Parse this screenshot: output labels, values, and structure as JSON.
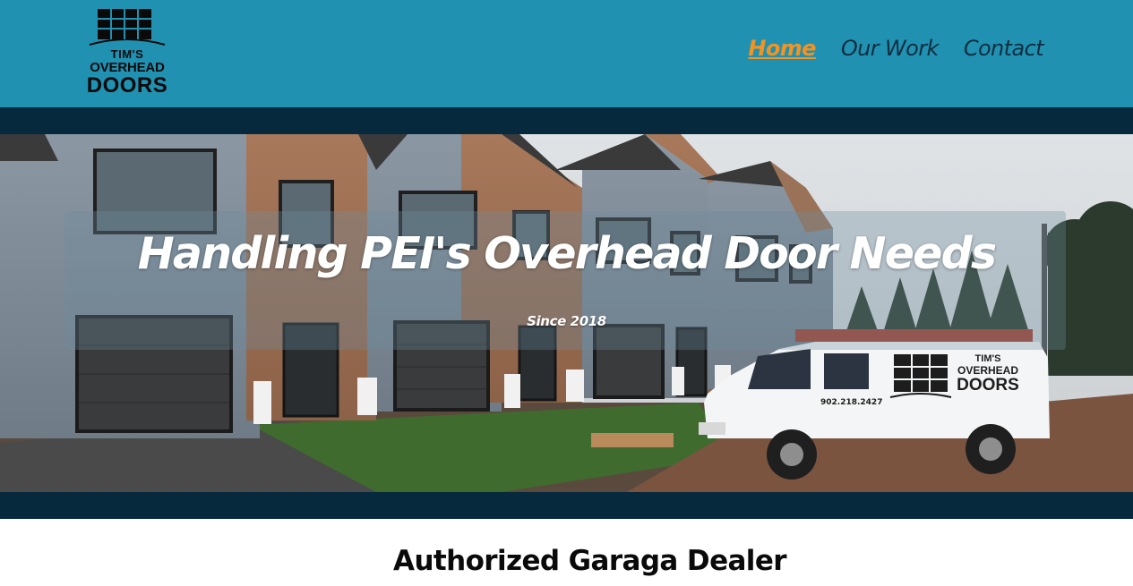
{
  "logo": {
    "line1": "TIM'S",
    "line2": "OVERHEAD",
    "line3": "DOORS"
  },
  "nav": {
    "items": [
      {
        "label": "Home",
        "active": true
      },
      {
        "label": "Our Work",
        "active": false
      },
      {
        "label": "Contact",
        "active": false
      }
    ]
  },
  "hero": {
    "title": "Handling PEI's Overhead Door Needs",
    "subtitle": "Since 2018",
    "van": {
      "phone": "902.218.2427",
      "brand_line1": "TIM'S",
      "brand_line2": "OVERHEAD",
      "brand_line3": "DOORS"
    }
  },
  "section": {
    "heading": "Authorized Garaga Dealer"
  },
  "colors": {
    "header_bg": "#2191b2",
    "band": "#07293d",
    "nav_text": "#0e2e40",
    "nav_active": "#f39321"
  }
}
